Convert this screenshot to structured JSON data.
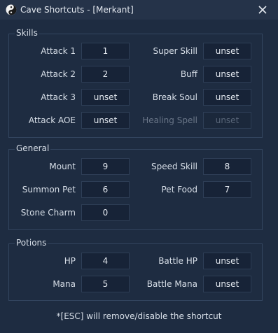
{
  "window": {
    "title": "Cave Shortcuts - [Merkant]"
  },
  "colors": {
    "background": "#1e2c41",
    "titlebar": "#253349",
    "field": "#172337",
    "border": "#33455f"
  },
  "icons": {
    "app": "yin-yang-icon",
    "close": "close-icon"
  },
  "skills": {
    "title": "Skills",
    "attack1": {
      "label": "Attack 1",
      "value": "1"
    },
    "attack2": {
      "label": "Attack 2",
      "value": "2"
    },
    "attack3": {
      "label": "Attack 3",
      "value": "unset"
    },
    "attack_aoe": {
      "label": "Attack AOE",
      "value": "unset"
    },
    "super_skill": {
      "label": "Super Skill",
      "value": "unset"
    },
    "buff": {
      "label": "Buff",
      "value": "unset"
    },
    "break_soul": {
      "label": "Break Soul",
      "value": "unset"
    },
    "healing_spell": {
      "label": "Healing Spell",
      "value": "unset"
    }
  },
  "general": {
    "title": "General",
    "mount": {
      "label": "Mount",
      "value": "9"
    },
    "summon_pet": {
      "label": "Summon Pet",
      "value": "6"
    },
    "stone_charm": {
      "label": "Stone Charm",
      "value": "0"
    },
    "speed_skill": {
      "label": "Speed Skill",
      "value": "8"
    },
    "pet_food": {
      "label": "Pet Food",
      "value": "7"
    }
  },
  "potions": {
    "title": "Potions",
    "hp": {
      "label": "HP",
      "value": "4"
    },
    "mana": {
      "label": "Mana",
      "value": "5"
    },
    "battle_hp": {
      "label": "Battle HP",
      "value": "unset"
    },
    "battle_mana": {
      "label": "Battle Mana",
      "value": "unset"
    }
  },
  "footnote": "*[ESC] will remove/disable the shortcut"
}
